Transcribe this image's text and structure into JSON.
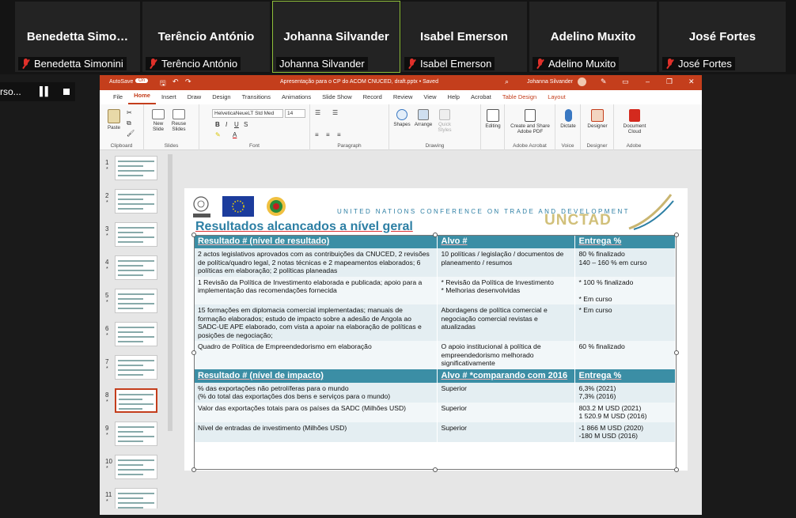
{
  "participants": [
    {
      "display": "Benedetta  Simo…",
      "label": "Benedetta Simonini",
      "muted": true,
      "active": false
    },
    {
      "display": "Terêncio António",
      "label": "Terêncio António",
      "muted": true,
      "active": false
    },
    {
      "display": "Johanna Silvander",
      "label": "Johanna Silvander",
      "muted": false,
      "active": true
    },
    {
      "display": "Isabel Emerson",
      "label": "Isabel Emerson",
      "muted": true,
      "active": false
    },
    {
      "display": "Adelino Muxito",
      "label": "Adelino Muxito",
      "muted": true,
      "active": false
    },
    {
      "display": "José Fortes",
      "label": "José Fortes",
      "muted": true,
      "active": false
    }
  ],
  "recording": {
    "label": "rso..."
  },
  "ppt": {
    "autosave": "AutoSave",
    "autosave_state": "On",
    "doc_title": "Apresentação para o CP do ACOM CNUCED, draft.pptx • Saved",
    "user": "Johanna Silvander",
    "tabs": [
      "File",
      "Home",
      "Insert",
      "Draw",
      "Design",
      "Transitions",
      "Animations",
      "Slide Show",
      "Record",
      "Review",
      "View",
      "Help",
      "Acrobat",
      "Table Design",
      "Layout"
    ],
    "ribbon": {
      "paste": "Paste",
      "new_slide": "New Slide",
      "reuse_slides": "Reuse Slides",
      "font_name": "HelveticaNeueLT Std Med",
      "font_size": "14",
      "shapes": "Shapes",
      "arrange": "Arrange",
      "quick_styles": "Quick Styles",
      "editing": "Editing",
      "create_share": "Create and Share Adobe PDF",
      "dictate": "Dictate",
      "designer": "Designer",
      "document_cloud": "Document Cloud",
      "groups": [
        "Clipboard",
        "Slides",
        "Font",
        "Paragraph",
        "Drawing",
        "Adobe Acrobat",
        "Voice",
        "Designer",
        "Adobe"
      ]
    },
    "thumbnails": [
      "1",
      "2",
      "3",
      "4",
      "5",
      "6",
      "7",
      "8",
      "9",
      "10",
      "11"
    ],
    "selected_slide": "8"
  },
  "slide": {
    "un_name": "UNITED NATIONS CONFERENCE ON TRADE AND DEVELOPMENT",
    "unctad": "UNCTAD",
    "title": "Resultados alcancados a nível geral",
    "headers1": [
      "Resultado # (nível de resultado)",
      "Alvo #",
      "Entrega %"
    ],
    "rows1": [
      {
        "c1": "2 actos legislativos aprovados com as contribuições da CNUCED, 2 revisões de política/quadro legal, 2 notas técnicas e 2 mapeamentos elaborados; 6 políticas em elaboração; 2 políticas planeadas",
        "c2": "10 políticas / legislação / documentos de planeamento / resumos",
        "c3": "80 % finalizado\n140 – 160 % em curso"
      },
      {
        "c1": "1 Revisão da Política de Investimento elaborada e publicada; apoio para a implementação das recomendações fornecida",
        "c2": "* Revisão da Política de Investimento\n* Melhorias desenvolvidas",
        "c3": "* 100 % finalizado\n\n* Em curso"
      },
      {
        "c1": "15 formações em diplomacia comercial implementadas; manuais de formação elaborados; estudo de impacto sobre a adesão de Angola ao SADC-UE APE elaborado, com vista a apoiar na elaboração de políticas e posições de negociação;",
        "c2": "Abordagens de política comercial e negociação comercial revistas e atualizadas",
        "c3": "* Em curso"
      },
      {
        "c1": "Quadro de Política de Empreendedorismo em elaboração",
        "c2": "O apoio institucional à política de empreendedorismo melhorado significativamente",
        "c3": "60 % finalizado"
      }
    ],
    "headers2": [
      "Resultado # (nível de impacto)",
      "Alvo # *comparando com 2016",
      "Entrega %"
    ],
    "rows2": [
      {
        "c1": "% das exportações não petrolíferas para o mundo\n(% do total das exportações dos bens e serviços para o mundo)",
        "c2": "Superior",
        "c3": "6,3% (2021)\n7,3% (2016)"
      },
      {
        "c1": "Valor das exportações totais para os países da SADC (Milhões USD)",
        "c2": "Superior",
        "c3": "803.2 M  USD (2021)\n1 520.9 M USD (2016)"
      },
      {
        "c1": "Nível de entradas de investimento (Milhões USD)",
        "c2": "Superior",
        "c3": "-1 866 M USD (2020)\n-180 M USD (2016)"
      }
    ]
  }
}
